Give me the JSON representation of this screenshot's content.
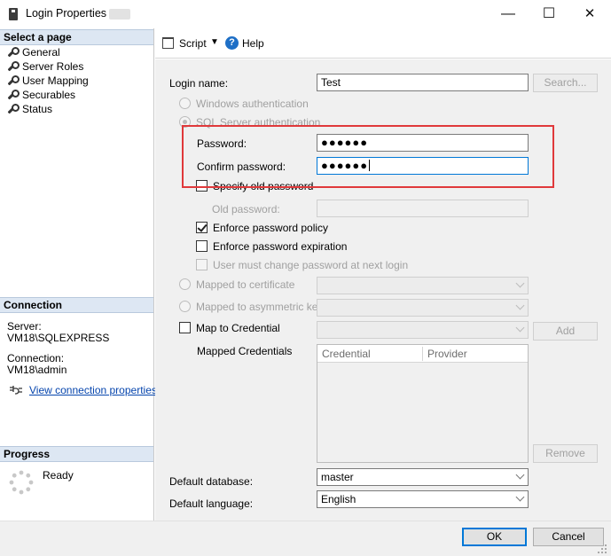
{
  "window": {
    "title": "Login Properties -",
    "minimize_glyph": "—",
    "maximize_glyph": "☐",
    "close_glyph": "✕"
  },
  "left": {
    "select_page_header": "Select a page",
    "pages": [
      {
        "label": "General",
        "icon": "wrench-icon"
      },
      {
        "label": "Server Roles",
        "icon": "wrench-icon"
      },
      {
        "label": "User Mapping",
        "icon": "wrench-icon"
      },
      {
        "label": "Securables",
        "icon": "wrench-icon"
      },
      {
        "label": "Status",
        "icon": "wrench-icon"
      }
    ],
    "connection_header": "Connection",
    "server_label": "Server:",
    "server_value": "VM18\\SQLEXPRESS",
    "connection_label": "Connection:",
    "connection_value": "VM18\\admin",
    "view_connection_properties": "View connection properties",
    "progress_header": "Progress",
    "progress_status": "Ready"
  },
  "toolbar": {
    "script_label": "Script",
    "help_label": "Help"
  },
  "form": {
    "login_name_label": "Login name:",
    "login_name_value": "Test",
    "search_button": "Search...",
    "windows_auth": "Windows authentication",
    "sql_auth": "SQL Server authentication",
    "password_label": "Password:",
    "password_value": "●●●●●●",
    "confirm_password_label": "Confirm password:",
    "confirm_password_value": "●●●●●●",
    "specify_old_password": "Specify old password",
    "old_password_label": "Old password:",
    "enforce_policy": "Enforce password policy",
    "enforce_policy_checked": true,
    "enforce_expiration": "Enforce password expiration",
    "enforce_expiration_checked": false,
    "must_change": "User must change password at next login",
    "mapped_certificate": "Mapped to certificate",
    "mapped_asym_key": "Mapped to asymmetric key",
    "map_credential": "Map to Credential",
    "add_button": "Add",
    "mapped_credentials_label": "Mapped Credentials",
    "grid_columns": [
      "Credential",
      "Provider"
    ],
    "remove_button": "Remove",
    "default_database_label": "Default database:",
    "default_database_value": "master",
    "default_language_label": "Default language:",
    "default_language_value": "English"
  },
  "footer": {
    "ok_button": "OK",
    "cancel_button": "Cancel"
  },
  "colors": {
    "highlight_border": "#e0393b",
    "section_header_bg": "#dde7f3",
    "link": "#0645ad",
    "focus": "#0078d7"
  }
}
